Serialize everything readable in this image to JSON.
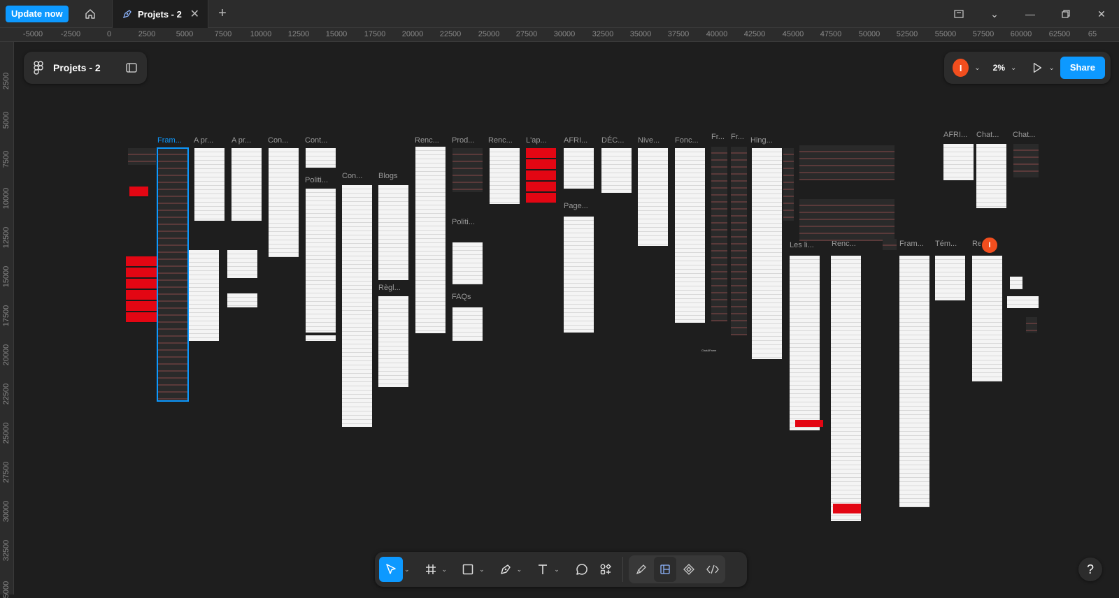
{
  "titlebar": {
    "update_label": "Update now",
    "tab_title": "Projets - 2"
  },
  "ruler": {
    "h_ticks": [
      "-5000",
      "-2500",
      "0",
      "2500",
      "5000",
      "7500",
      "10000",
      "12500",
      "15000",
      "17500",
      "20000",
      "22500",
      "25000",
      "27500",
      "30000",
      "32500",
      "35000",
      "37500",
      "40000",
      "42500",
      "45000",
      "47500",
      "50000",
      "52500",
      "55000",
      "57500",
      "60000",
      "62500",
      "65"
    ],
    "v_ticks": [
      "2500",
      "5000",
      "7500",
      "10000",
      "12500",
      "15000",
      "17500",
      "20000",
      "22500",
      "25000",
      "27500",
      "30000",
      "32500",
      "5000"
    ]
  },
  "file_panel": {
    "name": "Projets - 2"
  },
  "right_panel": {
    "avatar_initial": "I",
    "zoom": "2%",
    "share_label": "Share"
  },
  "canvas": {
    "frame_labels": [
      "Fram...",
      "A pr...",
      "A pr...",
      "Con...",
      "Cont...",
      "Politi...",
      "Con...",
      "Blogs",
      "Règl...",
      "Renc...",
      "Prod...",
      "Politi...",
      "FAQs",
      "Renc...",
      "L'ap...",
      "AFRI...",
      "DÉC...",
      "Page...",
      "Nive...",
      "Fonc...",
      "Fr...",
      "Fr...",
      "Hing...",
      "Les li...",
      "Renc...",
      "Fram...",
      "Tém...",
      "Re",
      "AFRI...",
      "Chat...",
      "Chat..."
    ],
    "chat_label": "Chat&Fame",
    "cursor_initial": "I"
  },
  "toolbar": {
    "tools": [
      "move-tool",
      "frame-tool",
      "shape-tool",
      "pen-tool",
      "text-tool",
      "comment-tool",
      "actions-tool"
    ],
    "dev_tools": [
      "draw-mode",
      "design-mode",
      "components-mode",
      "dev-mode"
    ]
  },
  "help_label": "?",
  "colors": {
    "accent": "#0d99ff",
    "brand_red": "#e30613",
    "avatar": "#f24e1e",
    "canvas": "#1e1e1e",
    "chrome": "#2c2c2c"
  }
}
